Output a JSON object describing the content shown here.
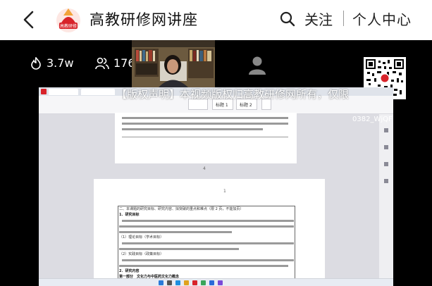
{
  "header": {
    "title": "高教研修网讲座",
    "follow_label": "关注",
    "profile_label": "个人中心"
  },
  "stats": {
    "views": "3.7w",
    "participants": "1762"
  },
  "video": {
    "copyright_notice": "【版权声明】本视频版权归高教研修网所有，仅限",
    "session_id": "0382_WjQF"
  },
  "document": {
    "ribbon_heading_1": "标题 1",
    "ribbon_heading_2": "标题 2",
    "page_number": "1",
    "table_header": "二、本课题的研究目标、研究内容、拟突破的重点和难点（限 2 页，不能加页）",
    "line_goal": "1．研究目标",
    "line_theory": "（1）理论目标（学术目标）",
    "line_practice": "（2）实践目标（政策目标）",
    "line_content": "2．研究内容",
    "line_part1": "第一部分　文化力与中医药文化力概念"
  },
  "colors": {
    "brand_red": "#d8232a",
    "video_bg": "#000000"
  }
}
